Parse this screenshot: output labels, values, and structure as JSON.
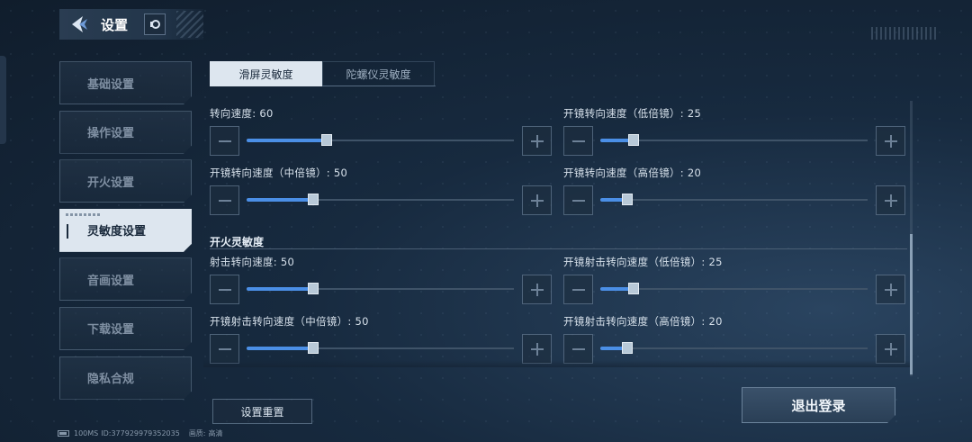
{
  "header": {
    "title": "设置"
  },
  "sidebar": {
    "items": [
      {
        "label": "基础设置"
      },
      {
        "label": "操作设置"
      },
      {
        "label": "开火设置"
      },
      {
        "label": "灵敏度设置",
        "active": true
      },
      {
        "label": "音画设置"
      },
      {
        "label": "下载设置"
      },
      {
        "label": "隐私合规"
      }
    ]
  },
  "tabs": [
    {
      "label": "滑屏灵敏度",
      "active": true
    },
    {
      "label": "陀螺仪灵敏度",
      "active": false
    }
  ],
  "sensitivity": {
    "items": [
      {
        "label": "转向速度: 60",
        "value": 60
      },
      {
        "label": "开镜转向速度（低倍镜）: 25",
        "value": 25
      },
      {
        "label": "开镜转向速度（中倍镜）: 50",
        "value": 50
      },
      {
        "label": "开镜转向速度（高倍镜）: 20",
        "value": 20
      }
    ]
  },
  "fire_sensitivity": {
    "title": "开火灵敏度",
    "items": [
      {
        "label": "射击转向速度: 50",
        "value": 50
      },
      {
        "label": "开镜射击转向速度（低倍镜）: 25",
        "value": 25
      },
      {
        "label": "开镜射击转向速度（中倍镜）: 50",
        "value": 50
      },
      {
        "label": "开镜射击转向速度（高倍镜）: 20",
        "value": 20
      }
    ]
  },
  "slider_max": 200,
  "buttons": {
    "reset": "设置重置",
    "logout": "退出登录"
  },
  "footer": {
    "ping": "100MS",
    "id": "ID:377929979352035",
    "quality_label": "画质:",
    "quality_value": "高清"
  },
  "colors": {
    "accent": "#4b8fe6",
    "active_bg": "#dde6ef"
  },
  "icons": {
    "back": "back-arrow-icon",
    "notice": "notice-icon",
    "minus": "minus-icon",
    "plus": "plus-icon",
    "battery": "battery-icon"
  }
}
